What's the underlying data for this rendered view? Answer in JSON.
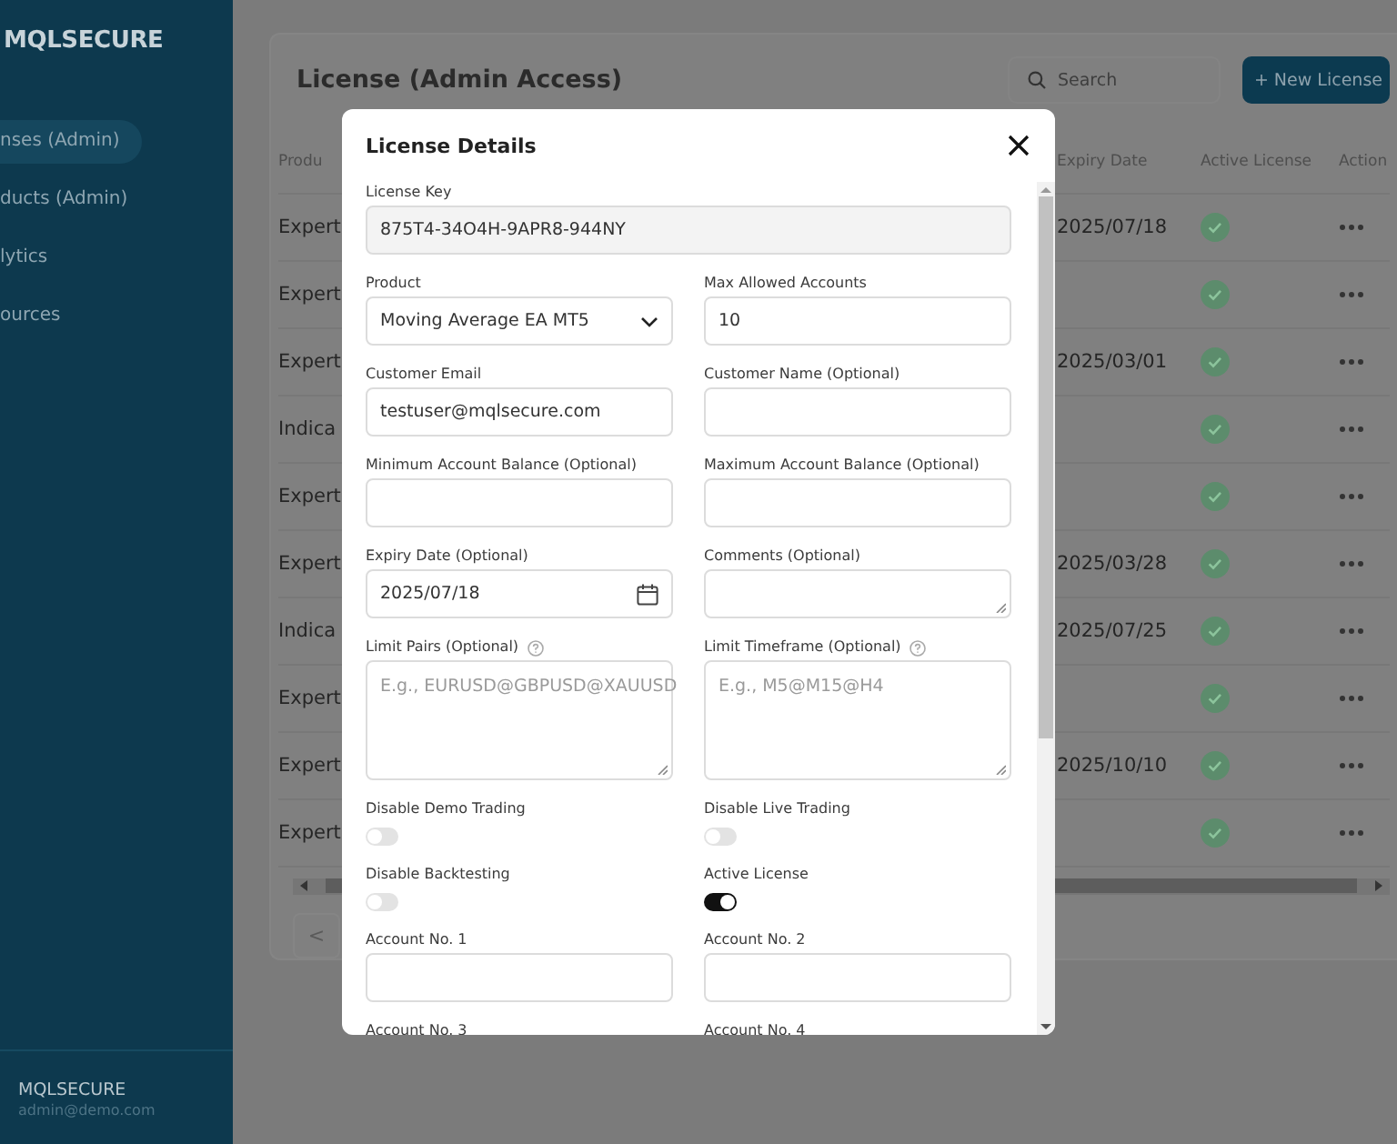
{
  "sidebar": {
    "logo": "MQLSECURE",
    "items": [
      {
        "label": "nses (Admin)",
        "selected": true
      },
      {
        "label": "ducts (Admin)",
        "selected": false
      },
      {
        "label": "lytics",
        "selected": false
      },
      {
        "label": "ources",
        "selected": false
      }
    ],
    "footer": {
      "name": "MQLSECURE",
      "email": "admin@demo.com"
    }
  },
  "page": {
    "title": "License (Admin Access)",
    "search": {
      "placeholder": "Search"
    },
    "new_button": "+ New License",
    "table": {
      "columns": [
        "Produ",
        "Expiry Date",
        "Active License",
        "Action"
      ],
      "rows": [
        {
          "product": "Expert",
          "expiry": "2025/07/18",
          "active": true
        },
        {
          "product": "Expert",
          "active": true
        },
        {
          "product": "Expert",
          "expiry": "2025/03/01",
          "active": true
        },
        {
          "product": "Indica",
          "active": true
        },
        {
          "product": "Expert",
          "active": true
        },
        {
          "product": "Expert",
          "expiry": "2025/03/28",
          "active": true
        },
        {
          "product": "Indica",
          "expiry": "2025/07/25",
          "active": true
        },
        {
          "product": "Expert",
          "active": true
        },
        {
          "product": "Expert",
          "expiry": "2025/10/10",
          "active": true
        },
        {
          "product": "Expert",
          "active": true
        }
      ]
    },
    "pagination": {
      "prev": "<"
    }
  },
  "modal": {
    "title": "License Details",
    "license_key": {
      "label": "License Key",
      "value": "875T4-34O4H-9APR8-944NY",
      "disabled": true
    },
    "fields": [
      {
        "kind": "select",
        "label": "Product",
        "value": "Moving Average EA MT5"
      },
      {
        "kind": "text",
        "label": "Max Allowed Accounts",
        "value": "10"
      },
      {
        "kind": "text",
        "label": "Customer Email",
        "value": "testuser@mqlsecure.com"
      },
      {
        "kind": "text",
        "label": "Customer Name (Optional)"
      },
      {
        "kind": "text",
        "label": "Minimum Account Balance (Optional)"
      },
      {
        "kind": "text",
        "label": "Maximum Account Balance (Optional)"
      },
      {
        "kind": "date",
        "label": "Expiry Date (Optional)",
        "value": "2025/07/18"
      },
      {
        "kind": "comment",
        "label": "Comments (Optional)"
      },
      {
        "kind": "textarea",
        "label": "Limit Pairs (Optional)",
        "help": true,
        "placeholder": "E.g., EURUSD@GBPUSD@XAUUSD"
      },
      {
        "kind": "textarea",
        "label": "Limit Timeframe (Optional)",
        "help": true,
        "placeholder": "E.g., M5@M15@H4"
      },
      {
        "kind": "toggle",
        "label": "Disable Demo Trading",
        "on": false
      },
      {
        "kind": "toggle",
        "label": "Disable Live Trading",
        "on": false
      },
      {
        "kind": "toggle",
        "label": "Disable Backtesting",
        "on": false
      },
      {
        "kind": "toggle",
        "label": "Active License",
        "on": true
      },
      {
        "kind": "text",
        "label": "Account No. 1"
      },
      {
        "kind": "text",
        "label": "Account No. 2"
      },
      {
        "kind": "label",
        "label": "Account No. 3"
      },
      {
        "kind": "label",
        "label": "Account No. 4"
      }
    ]
  }
}
